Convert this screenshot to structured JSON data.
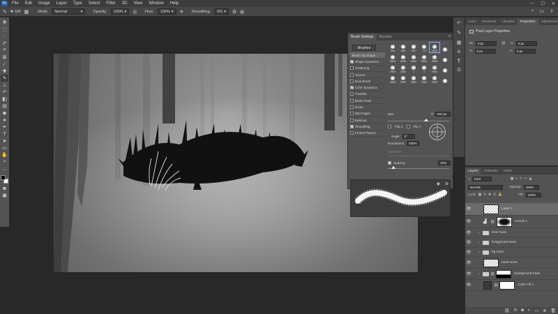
{
  "menu": [
    "File",
    "Edit",
    "Image",
    "Layer",
    "Type",
    "Select",
    "Filter",
    "3D",
    "View",
    "Window",
    "Help"
  ],
  "logo_text": "Ps",
  "options_bar": {
    "brush_size": "504",
    "mode_label": "Mode:",
    "mode_value": "Normal",
    "opacity_label": "Opacity:",
    "opacity_value": "100%",
    "flow_label": "Flow:",
    "flow_value": "100%",
    "smoothing_label": "Smoothing:",
    "smoothing_value": "0%"
  },
  "brush_panel": {
    "tabs": [
      "Brush Settings",
      "Brushes"
    ],
    "brushes_button": "Brushes",
    "settings": [
      {
        "label": "Brush Tip Shape",
        "checked": null
      },
      {
        "label": "Shape Dynamics",
        "checked": true
      },
      {
        "label": "Scattering",
        "checked": false
      },
      {
        "label": "Texture",
        "checked": false
      },
      {
        "label": "Dual Brush",
        "checked": false
      },
      {
        "label": "Color Dynamics",
        "checked": true
      },
      {
        "label": "Transfer",
        "checked": false
      },
      {
        "label": "Brush Pose",
        "checked": false
      },
      {
        "label": "Noise",
        "checked": false
      },
      {
        "label": "Wet Edges",
        "checked": false
      },
      {
        "label": "Build-up",
        "checked": false
      },
      {
        "label": "Smoothing",
        "checked": true
      },
      {
        "label": "Protect Texture",
        "checked": false
      }
    ],
    "presets": [
      "349",
      "538",
      "907",
      "774",
      "2500",
      "",
      "2500",
      "2500",
      "2500",
      "2500",
      "2500",
      "",
      "2500",
      "2500",
      "1",
      "1",
      "2500",
      "",
      "2500",
      "2500",
      "2500",
      "2500",
      "2500",
      ""
    ],
    "size_label": "Size",
    "size_value": "504 px",
    "flip_x": "Flip X",
    "flip_y": "Flip Y",
    "angle_label": "Angle:",
    "angle_value": "0°",
    "roundness_label": "Roundness:",
    "roundness_value": "100%",
    "hardness_label": "Hardness",
    "spacing_label": "Spacing",
    "spacing_value": "10%"
  },
  "properties_panel": {
    "tabs": [
      "Color",
      "Swatches",
      "Libraries",
      "Properties",
      "Adjustments"
    ],
    "title": "Pixel Layer Properties",
    "w_label": "W:",
    "w_value": "0 px",
    "h_label": "H:",
    "h_value": "0 px",
    "x_label": "X:",
    "x_value": "0 px",
    "y_label": "Y:",
    "y_value": "0 px"
  },
  "layers_panel": {
    "tabs": [
      "Layers",
      "Channels",
      "Paths"
    ],
    "filter_label": "Kind",
    "blend_mode": "Normal",
    "opacity_label": "Opacity:",
    "opacity_value": "100%",
    "lock_label": "Lock:",
    "fill_label": "Fill:",
    "fill_value": "100%",
    "layers": [
      {
        "name": "Layer 1",
        "type": "pixel",
        "selected": true
      },
      {
        "name": "Levels 1",
        "type": "adjustment",
        "selected": false
      },
      {
        "name": "front haze",
        "type": "group",
        "selected": false
      },
      {
        "name": "foreground trees",
        "type": "group",
        "selected": false
      },
      {
        "name": "bg haze",
        "type": "group",
        "selected": false
      },
      {
        "name": "back snow",
        "type": "pixel",
        "selected": false
      },
      {
        "name": "background trees",
        "type": "group-mask",
        "selected": false
      },
      {
        "name": "Color Fill 1",
        "type": "fill",
        "selected": false
      }
    ]
  }
}
